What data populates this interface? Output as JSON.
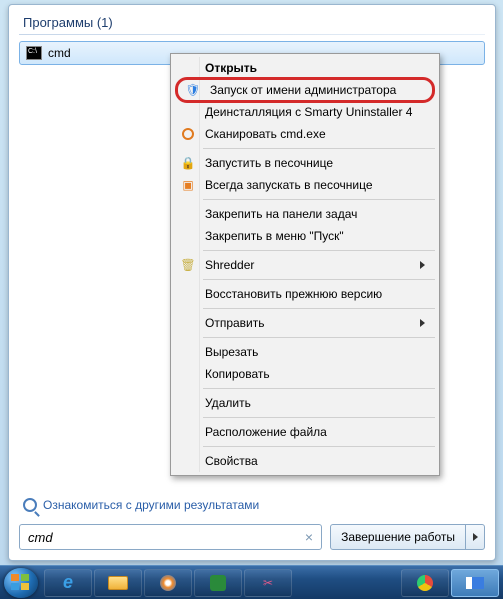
{
  "header": {
    "programs_label": "Программы (1)"
  },
  "result": {
    "label": "cmd"
  },
  "context_menu": {
    "open": "Открыть",
    "run_as_admin": "Запуск от имени администратора",
    "uninstall_smarty": "Деинсталляция с Smarty Uninstaller 4",
    "scan_cmd": "Сканировать cmd.exe",
    "run_sandbox": "Запустить в песочнице",
    "always_sandbox": "Всегда запускать в песочнице",
    "pin_taskbar": "Закрепить на панели задач",
    "pin_start": "Закрепить в меню \"Пуск\"",
    "shredder": "Shredder",
    "restore_prev": "Восстановить прежнюю версию",
    "send_to": "Отправить",
    "cut": "Вырезать",
    "copy": "Копировать",
    "delete": "Удалить",
    "open_location": "Расположение файла",
    "properties": "Свойства"
  },
  "footer": {
    "see_more": "Ознакомиться с другими результатами",
    "search_value": "cmd",
    "shutdown": "Завершение работы"
  },
  "taskbar_icons": [
    "ie",
    "explorer",
    "wmp",
    "mediacenter",
    "snip",
    "chrome",
    "manager"
  ]
}
